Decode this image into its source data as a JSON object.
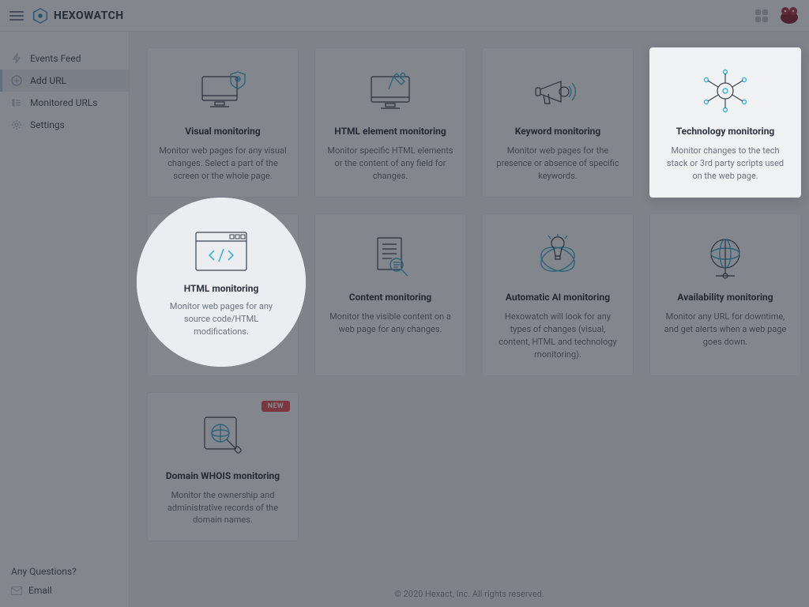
{
  "brand": "HEXOWATCH",
  "sidebar": {
    "items": [
      {
        "label": "Events Feed",
        "icon": "lightning-icon",
        "active": false
      },
      {
        "label": "Add URL",
        "icon": "plus-circle-icon",
        "active": true
      },
      {
        "label": "Monitored URLs",
        "icon": "list-icon",
        "active": false
      },
      {
        "label": "Settings",
        "icon": "gear-icon",
        "active": false
      }
    ],
    "questions_label": "Any Questions?",
    "email_label": "Email"
  },
  "cards": [
    {
      "key": "visual",
      "title": "Visual monitoring",
      "desc": "Monitor web pages for any visual changes. Select a part of the screen or the whole page.",
      "icon": "monitor-shield"
    },
    {
      "key": "html-element",
      "title": "HTML element monitoring",
      "desc": "Monitor specific HTML elements or the content of any field for changes.",
      "icon": "monitor-pin"
    },
    {
      "key": "keyword",
      "title": "Keyword monitoring",
      "desc": "Monitor web pages for the presence or absence of specific keywords.",
      "icon": "megaphone"
    },
    {
      "key": "technology",
      "title": "Technology monitoring",
      "desc": "Monitor changes to the tech stack or 3rd party scripts used on the web page.",
      "icon": "network",
      "highlight": true
    },
    {
      "key": "html",
      "title": "HTML monitoring",
      "desc": "Monitor web pages for any source code/HTML modifications.",
      "icon": "code-window",
      "spotlight": true
    },
    {
      "key": "content",
      "title": "Content monitoring",
      "desc": "Monitor the visible content on a web page for any changes.",
      "icon": "doc-search"
    },
    {
      "key": "ai",
      "title": "Automatic AI monitoring",
      "desc": "Hexowatch will look for any types of changes (visual, content, HTML and technology monitoring).",
      "icon": "ai-bulb"
    },
    {
      "key": "availability",
      "title": "Availability monitoring",
      "desc": "Monitor any URL for downtime, and get alerts when a web page goes down.",
      "icon": "globe"
    },
    {
      "key": "whois",
      "title": "Domain WHOIS monitoring",
      "desc": "Monitor the ownership and administrative records of the domain names.",
      "icon": "magnify-globe",
      "badge": "NEW"
    }
  ],
  "footer": "© 2020 Hexact, Inc. All rights reserved."
}
